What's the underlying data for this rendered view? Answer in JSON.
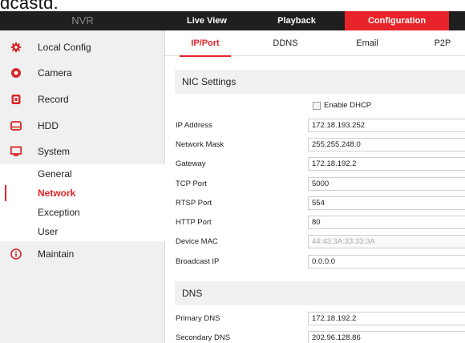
{
  "cut_text": "dcastd.",
  "topnav": {
    "brand": "NVR",
    "tabs": [
      {
        "label": "Live View"
      },
      {
        "label": "Playback"
      },
      {
        "label": "Configuration"
      }
    ]
  },
  "sidebar": {
    "items": [
      {
        "label": "Local Config",
        "icon": "gear-icon"
      },
      {
        "label": "Camera",
        "icon": "camera-icon"
      },
      {
        "label": "Record",
        "icon": "record-icon"
      },
      {
        "label": "HDD",
        "icon": "hdd-icon"
      },
      {
        "label": "System",
        "icon": "monitor-icon"
      },
      {
        "label": "Maintain",
        "icon": "info-icon"
      }
    ],
    "system_sub": [
      {
        "label": "General"
      },
      {
        "label": "Network"
      },
      {
        "label": "Exception"
      },
      {
        "label": "User"
      }
    ]
  },
  "subtabs": [
    {
      "label": "IP/Port"
    },
    {
      "label": "DDNS"
    },
    {
      "label": "Email"
    },
    {
      "label": "P2P"
    }
  ],
  "nic": {
    "title": "NIC Settings",
    "dhcp_label": "Enable DHCP",
    "fields": [
      {
        "label": "IP Address",
        "value": "172.18.193.252"
      },
      {
        "label": "Network Mask",
        "value": "255.255.248.0"
      },
      {
        "label": "Gateway",
        "value": "172.18.192.2"
      },
      {
        "label": "TCP Port",
        "value": "5000"
      },
      {
        "label": "RTSP Port",
        "value": "554"
      },
      {
        "label": "HTTP Port",
        "value": "80"
      },
      {
        "label": "Device MAC",
        "value": "44:43:3A:33:33:3A"
      },
      {
        "label": "Broadcast IP",
        "value": "0.0.0.0"
      }
    ]
  },
  "dns": {
    "title": "DNS",
    "fields": [
      {
        "label": "Primary DNS",
        "value": "172.18.192.2"
      },
      {
        "label": "Secondary DNS",
        "value": "202.96.128.86"
      }
    ]
  },
  "colors": {
    "accent": "#e8232a",
    "topbar": "#1f1f1f",
    "sidebar": "#f0f0f0",
    "section": "#f1f1f1"
  }
}
